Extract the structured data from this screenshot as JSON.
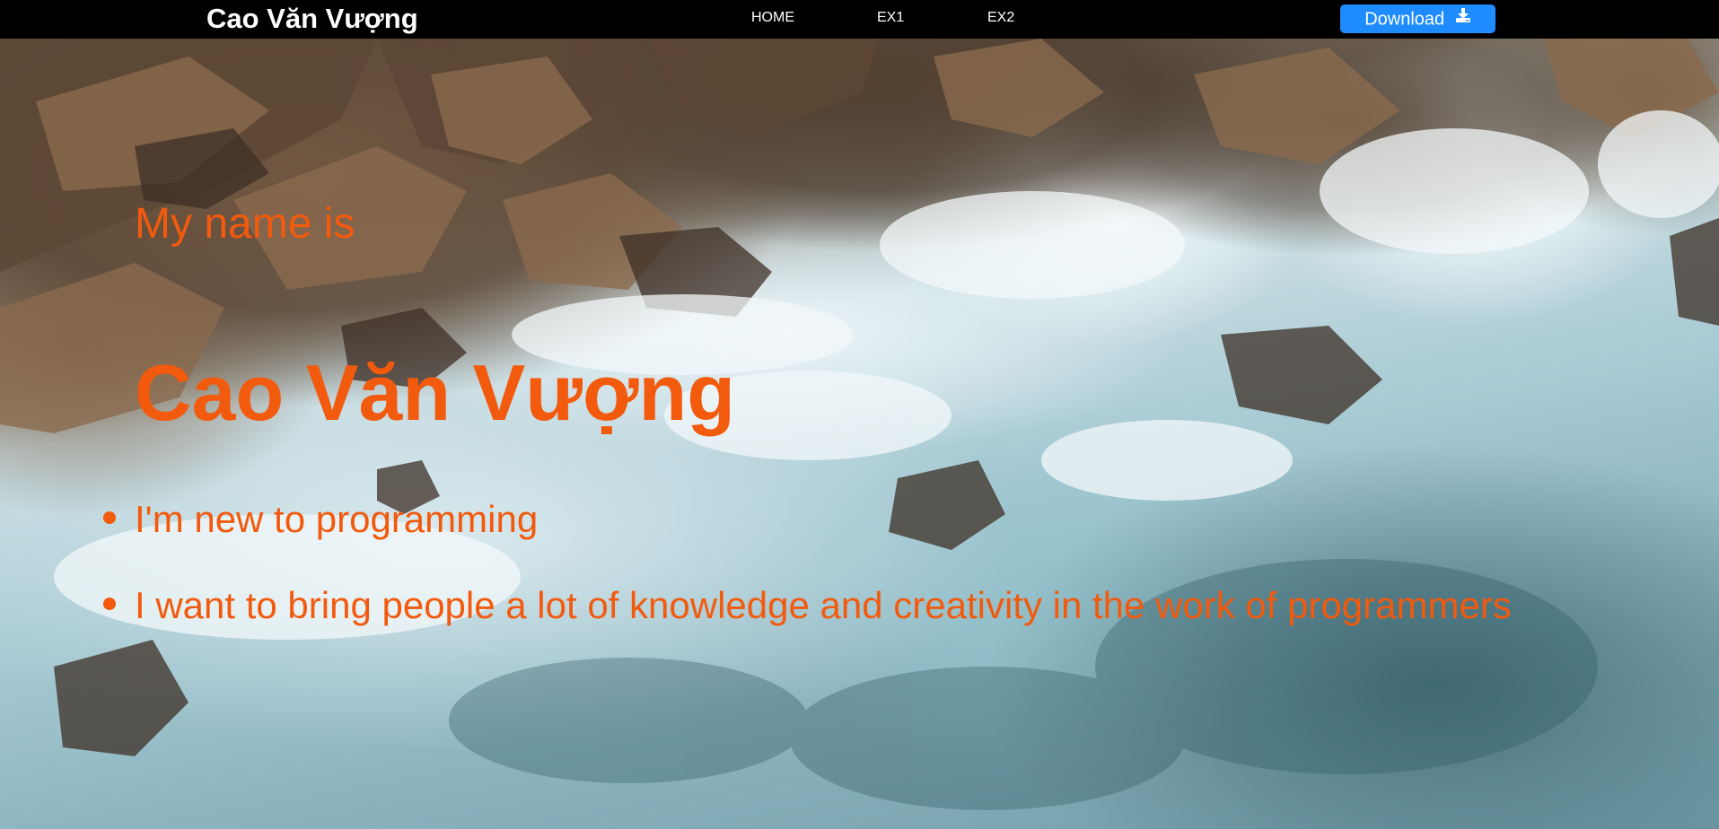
{
  "navbar": {
    "brand": "Cao Văn Vượng",
    "links": [
      "HOME",
      "EX1",
      "EX2"
    ],
    "download_label": "Download",
    "download_icon": "download-icon",
    "download_color": "#1e8cff",
    "background": "#000000"
  },
  "hero": {
    "intro": "My name is",
    "name": "Cao Văn Vượng",
    "bullets": [
      "I'm new to programming",
      "I want to bring people a lot of knowledge and creativity in the work of programmers"
    ],
    "text_color": "#f25a0e",
    "background_image": "aerial view of ocean waves crashing on rocks"
  }
}
